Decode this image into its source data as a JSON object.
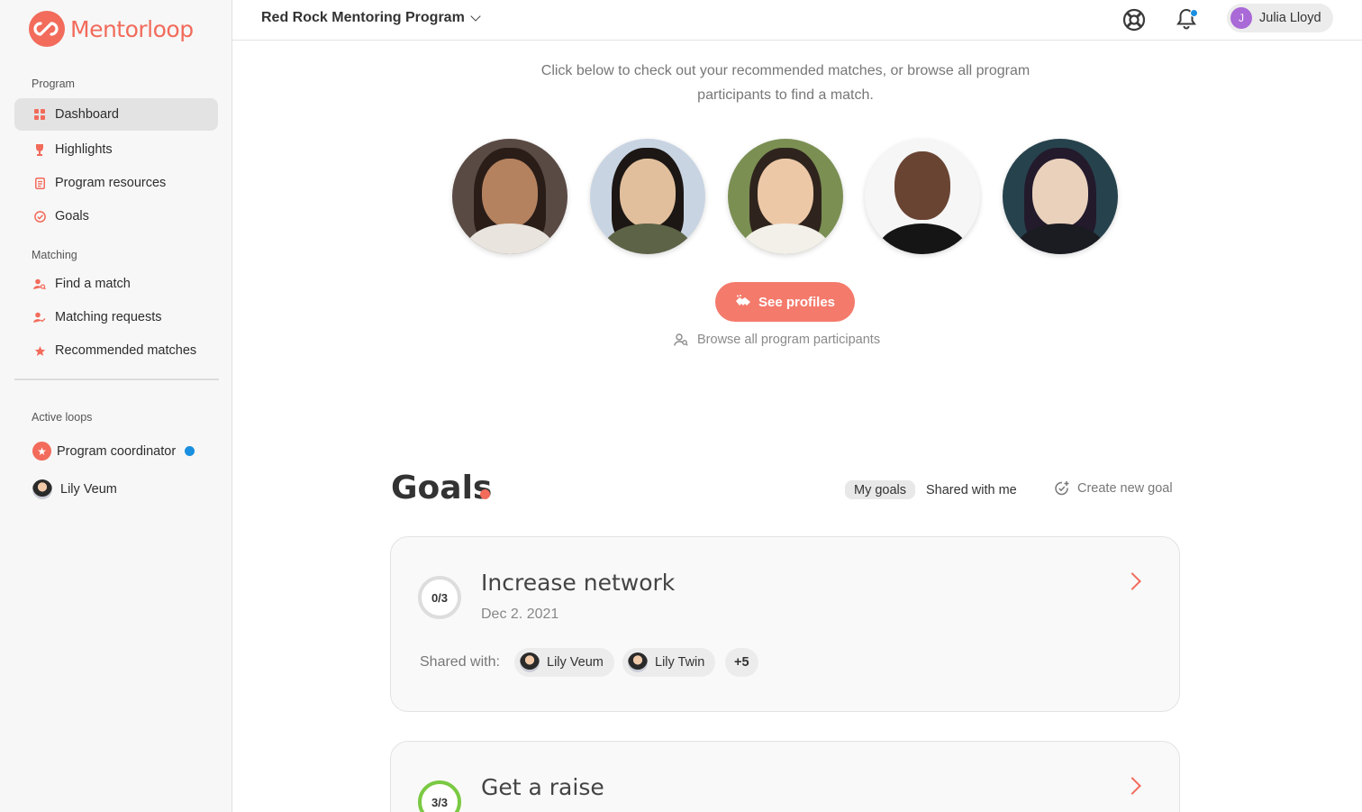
{
  "brand": {
    "name": "Mentorloop",
    "color": "#f26b5b"
  },
  "sidebar": {
    "program_label": "Program",
    "program_items": [
      {
        "label": "Dashboard",
        "icon": "dashboard-icon",
        "active": true
      },
      {
        "label": "Highlights",
        "icon": "trophy-icon"
      },
      {
        "label": "Program resources",
        "icon": "document-icon"
      },
      {
        "label": "Goals",
        "icon": "goal-check-icon"
      }
    ],
    "matching_label": "Matching",
    "matching_items": [
      {
        "label": "Find a match",
        "icon": "person-search-icon"
      },
      {
        "label": "Matching requests",
        "icon": "person-check-icon"
      },
      {
        "label": "Recommended matches",
        "icon": "star-icon"
      }
    ],
    "loops_label": "Active loops",
    "loops": [
      {
        "label": "Program coordinator",
        "icon": "star-badge-icon",
        "unread": true
      },
      {
        "label": "Lily Veum",
        "icon": "avatar"
      }
    ]
  },
  "topbar": {
    "program_name": "Red Rock Mentoring Program",
    "user": {
      "initial": "J",
      "name": "Julia Lloyd"
    }
  },
  "recommendations": {
    "intro": "Click below to check out your recommended matches, or browse all program participants to find a match.",
    "see_profiles_label": "See profiles",
    "browse_label": "Browse all program participants"
  },
  "goals": {
    "title": "Goals",
    "tabs": [
      "My goals",
      "Shared with me"
    ],
    "active_tab": "My goals",
    "create_label": "Create new goal",
    "shared_with_label": "Shared with:",
    "items": [
      {
        "title": "Increase network",
        "date": "Dec 2. 2021",
        "progress": "0/3",
        "completed": 0,
        "total": 3,
        "shared_with": [
          "Lily Veum",
          "Lily Twin"
        ],
        "more": "+5"
      },
      {
        "title": "Get a raise",
        "progress": "3/3",
        "completed": 3,
        "total": 3
      }
    ]
  },
  "colors": {
    "accent": "#f26b5b",
    "notification": "#1a8fe0",
    "progress_complete": "#7ac943",
    "progress_empty": "#dddddd"
  }
}
